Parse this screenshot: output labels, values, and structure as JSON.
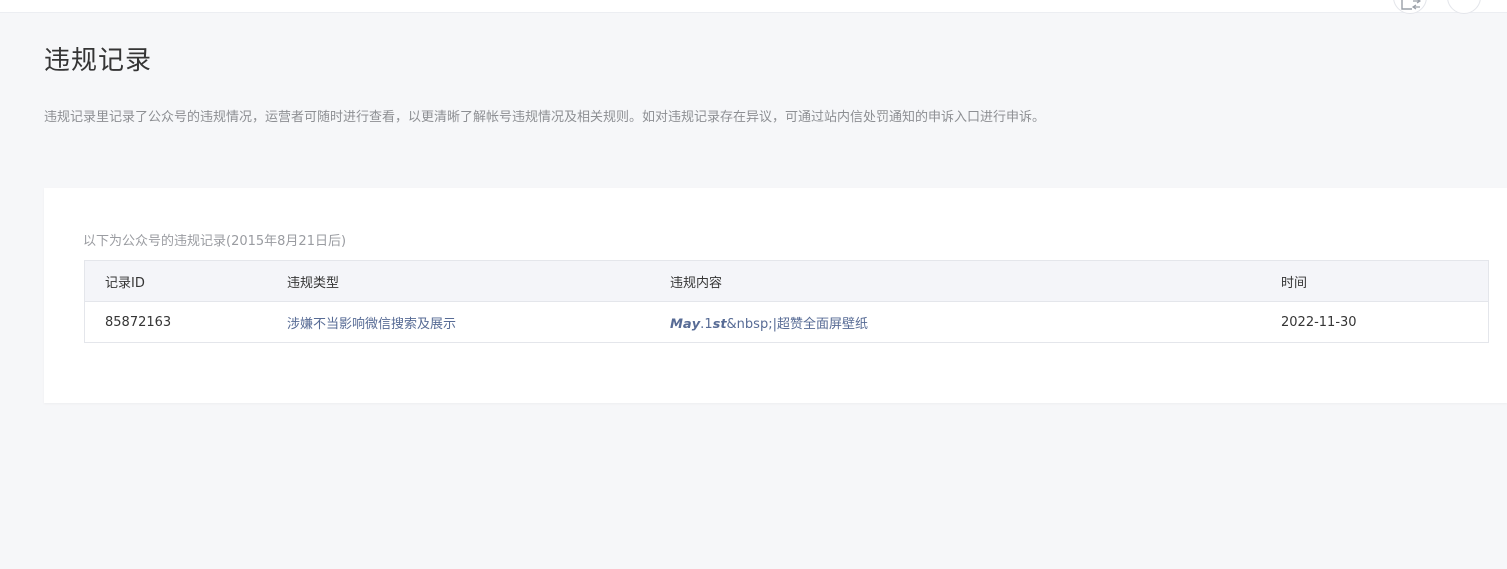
{
  "page": {
    "title": "违规记录",
    "description": "违规记录里记录了公众号的违规情况，运营者可随时进行查看，以更清晰了解帐号违规情况及相关规则。如对违规记录存在异议，可通过站内信处罚通知的申诉入口进行申诉。"
  },
  "records": {
    "caption": "以下为公众号的违规记录(2015年8月21日后)",
    "headers": {
      "id": "记录ID",
      "type": "违规类型",
      "content": "违规内容",
      "time": "时间"
    },
    "rows": [
      {
        "id": "85872163",
        "type": "涉嫌不当影响微信搜索及展示",
        "content_prefix": "𝙈𝙖𝙮.1𝙨𝙩",
        "content_suffix": "&nbsp;|超赞全面屏壁纸",
        "time": "2022-11-30"
      }
    ]
  },
  "icons": {
    "top_right_1": "switch-account-icon",
    "top_right_2": "avatar-icon"
  },
  "colors": {
    "background": "#f6f7f9",
    "link": "#576b95",
    "muted_text": "#8d8f93"
  }
}
